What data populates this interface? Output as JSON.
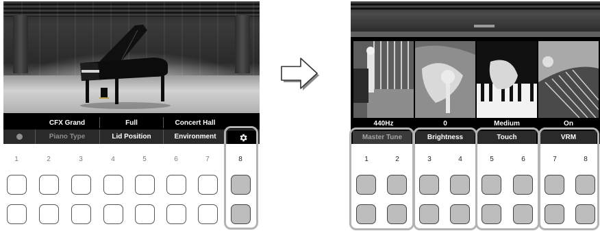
{
  "left_screen": {
    "values": [
      "CFX Grand",
      "Full",
      "Concert Hall"
    ],
    "labels": [
      "Piano Type",
      "Lid Position",
      "Environment"
    ],
    "status_indicator": "dot",
    "settings_icon": "gear-icon"
  },
  "right_screen": {
    "values": [
      "440Hz",
      "0",
      "Medium",
      "On"
    ],
    "labels": [
      "Master Tune",
      "Brightness",
      "Touch",
      "VRM"
    ]
  },
  "button_numbers": [
    "1",
    "2",
    "3",
    "4",
    "5",
    "6",
    "7",
    "8"
  ],
  "navigation_arrow_icon": "right-arrow-icon",
  "colors": {
    "screen_background": "#000000",
    "label_bar": "#2a2a2a",
    "active_button": "#bdbdbd",
    "highlight_frame": "#b3b3b3"
  }
}
